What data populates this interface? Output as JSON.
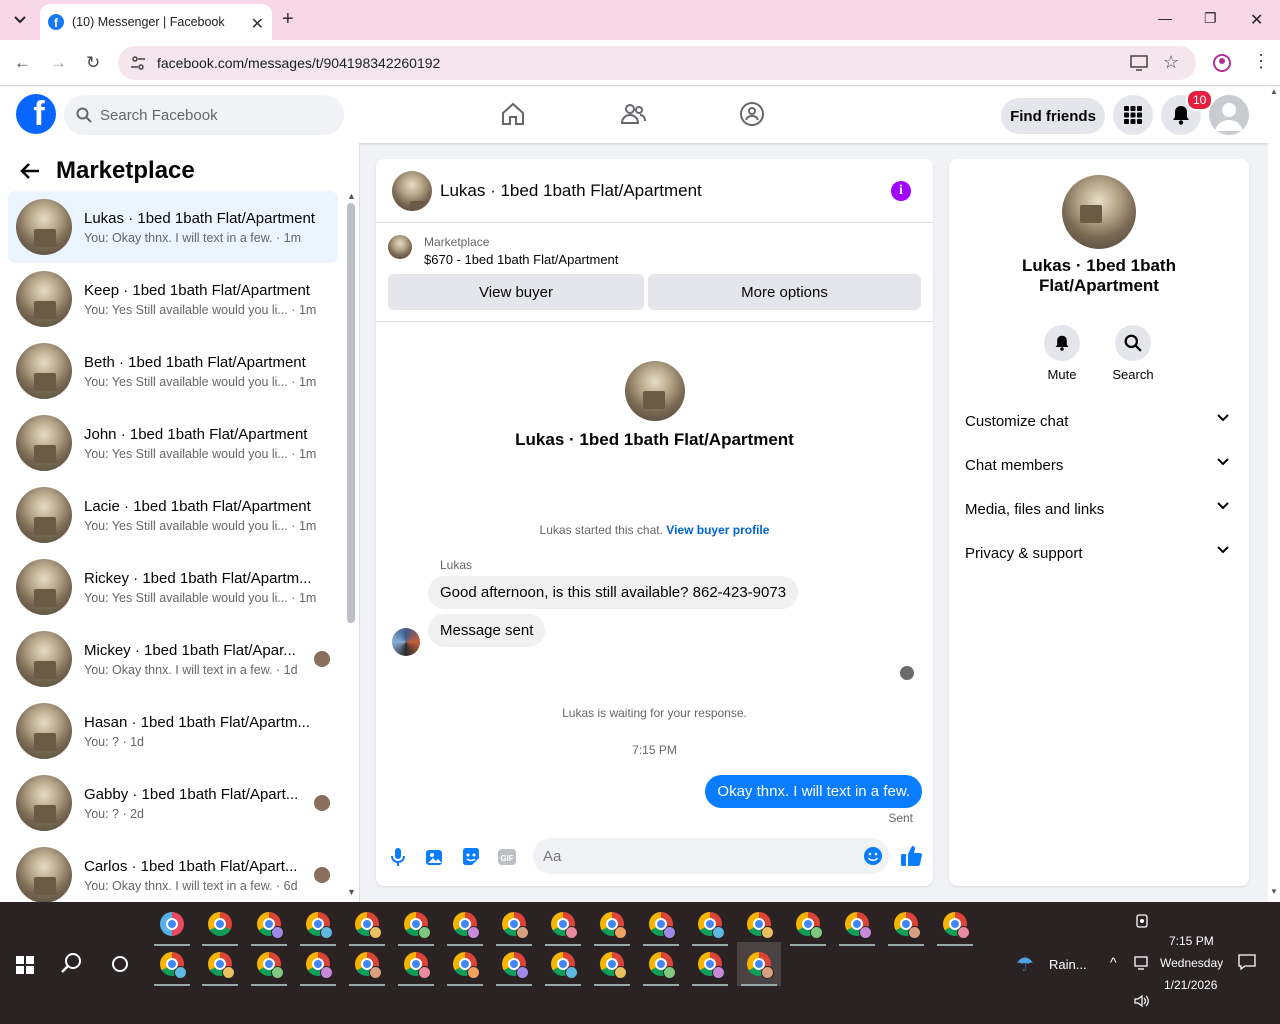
{
  "browser": {
    "tab_title": "(10) Messenger | Facebook",
    "url": "facebook.com/messages/t/904198342260192"
  },
  "fb_header": {
    "search_placeholder": "Search Facebook",
    "find_friends": "Find friends",
    "notification_count": "10"
  },
  "sidebar": {
    "title": "Marketplace",
    "conversations": [
      {
        "name": "Lukas · 1bed 1bath Flat/Apartment",
        "preview": "You: Okay thnx. I will text in a few. · 1m",
        "active": true
      },
      {
        "name": "Keep · 1bed 1bath Flat/Apartment",
        "preview": "You: Yes Still available would you li... · 1m"
      },
      {
        "name": "Beth · 1bed 1bath Flat/Apartment",
        "preview": "You: Yes Still available would you li... · 1m"
      },
      {
        "name": "John · 1bed 1bath Flat/Apartment",
        "preview": "You: Yes Still available would you li... · 1m"
      },
      {
        "name": "Lacie · 1bed 1bath Flat/Apartment",
        "preview": "You: Yes Still available would you li... · 1m"
      },
      {
        "name": "Rickey · 1bed 1bath Flat/Apartm...",
        "preview": "You: Yes Still available would you li... · 1m"
      },
      {
        "name": "Mickey · 1bed 1bath Flat/Apar...",
        "preview": "You: Okay thnx. I will text in a few. · 1d",
        "seen": true
      },
      {
        "name": "Hasan · 1bed 1bath Flat/Apartm...",
        "preview": "You: ? · 1d"
      },
      {
        "name": "Gabby · 1bed 1bath Flat/Apart...",
        "preview": "You: ? · 2d",
        "seen": true
      },
      {
        "name": "Carlos · 1bed 1bath Flat/Apart...",
        "preview": "You: Okay thnx. I will text in a few. · 6d",
        "seen": true
      }
    ]
  },
  "chat": {
    "title": "Lukas · 1bed 1bath Flat/Apartment",
    "marketplace_label": "Marketplace",
    "listing": "$670 - 1bed 1bath Flat/Apartment",
    "view_buyer": "View buyer",
    "more_options": "More options",
    "profile_name": "Lukas · 1bed 1bath Flat/Apartment",
    "started_text": "Lukas started this chat.",
    "view_buyer_profile": "View buyer profile",
    "sender": "Lukas",
    "msg1": "Good afternoon, is this still available? 862-423-9073",
    "msg2": "Message sent",
    "waiting": "Lukas is waiting for your response.",
    "time": "7:15 PM",
    "my_msg": "Okay thnx. I will text in a few.",
    "sent_status": "Sent",
    "compose_placeholder": "Aa"
  },
  "details": {
    "name_line1": "Lukas · 1bed 1bath",
    "name_line2": "Flat/Apartment",
    "mute": "Mute",
    "search": "Search",
    "sections": [
      "Customize chat",
      "Chat members",
      "Media, files and links",
      "Privacy & support"
    ]
  },
  "taskbar": {
    "weather": "Rain...",
    "time": "7:15 PM",
    "day": "Wednesday",
    "date": "1/21/2026"
  },
  "colors": {
    "fb_blue": "#0866ff",
    "my_bubble": "#0a7cff",
    "info": "#a200ff",
    "badge": "#e41e3f"
  }
}
